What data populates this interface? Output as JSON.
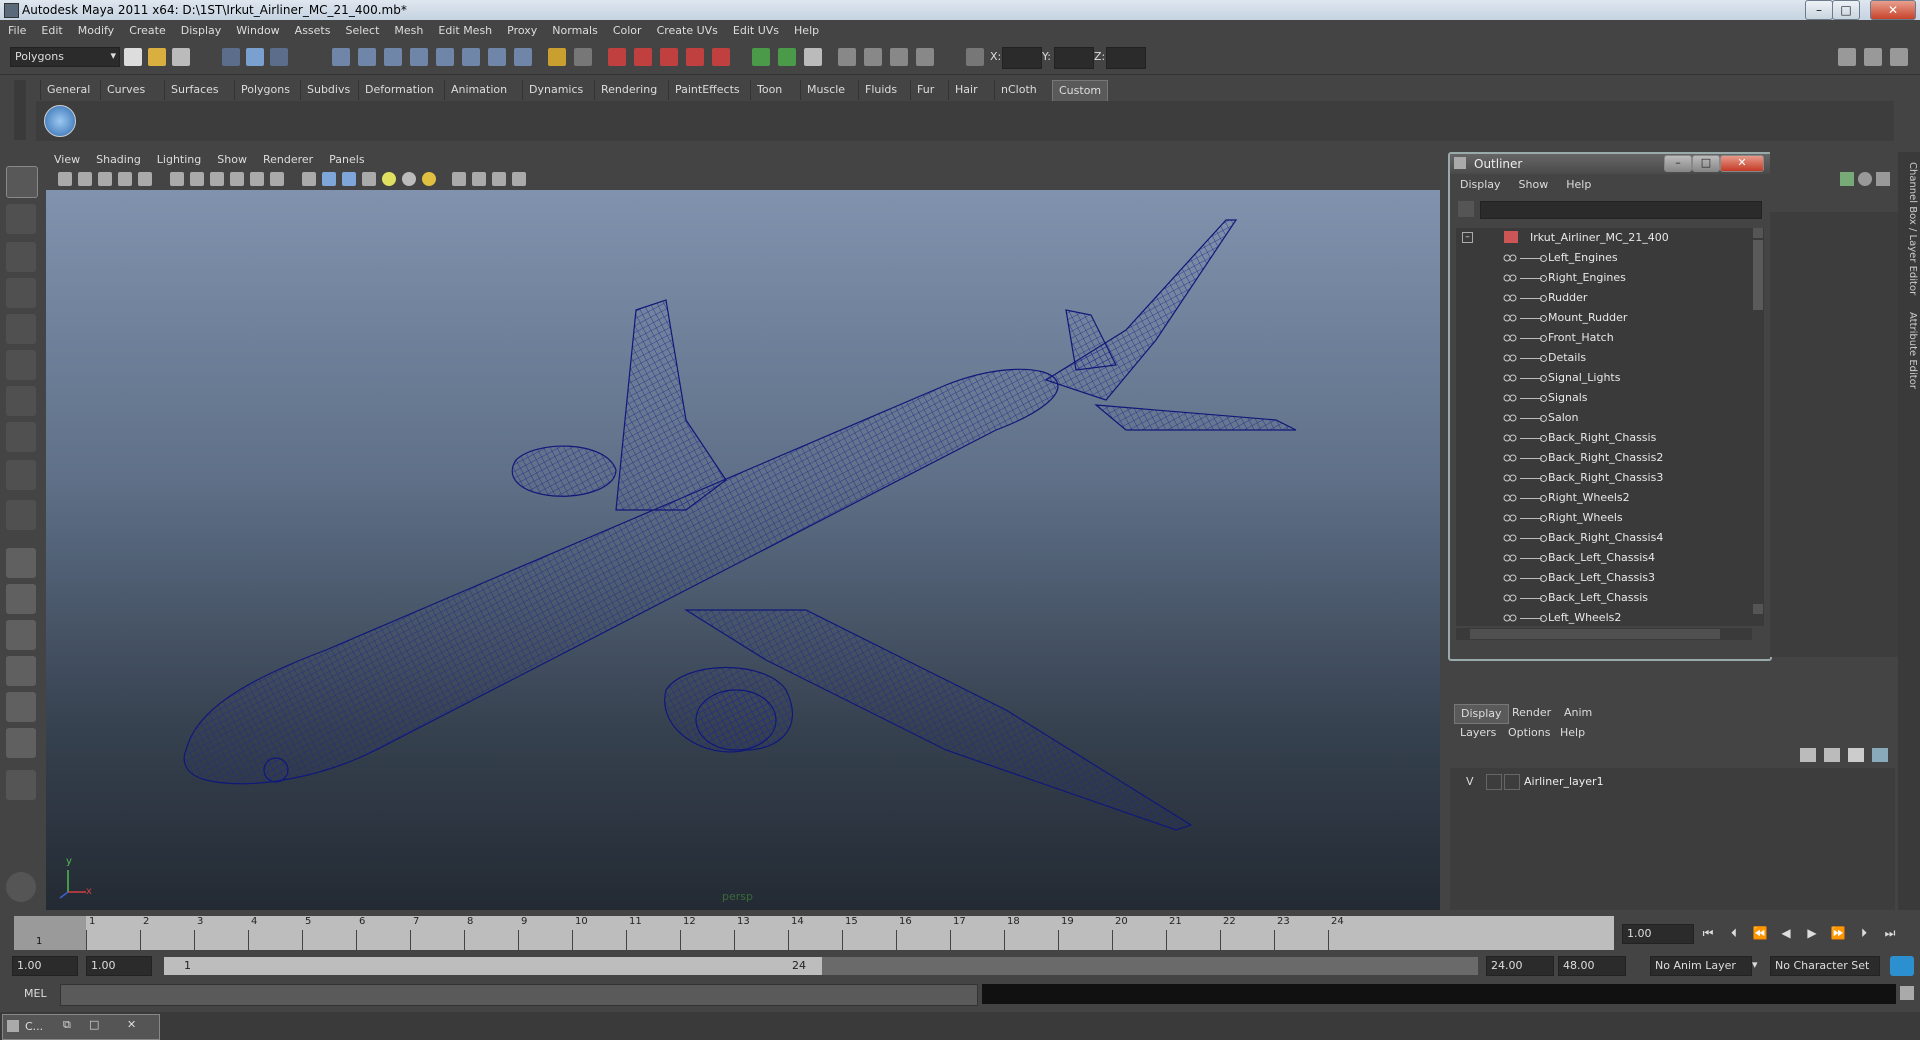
{
  "window": {
    "title": "Autodesk Maya 2011 x64: D:\\1ST\\Irkut_Airliner_MC_21_400.mb*"
  },
  "menubar": [
    "File",
    "Edit",
    "Modify",
    "Create",
    "Display",
    "Window",
    "Assets",
    "Select",
    "Mesh",
    "Edit Mesh",
    "Proxy",
    "Normals",
    "Color",
    "Create UVs",
    "Edit UVs",
    "Help"
  ],
  "status": {
    "mode": "Polygons",
    "x_label": "X:",
    "y_label": "Y:",
    "z_label": "Z:"
  },
  "shelf_tabs": [
    "General",
    "Curves",
    "Surfaces",
    "Polygons",
    "Subdivs",
    "Deformation",
    "Animation",
    "Dynamics",
    "Rendering",
    "PaintEffects",
    "Toon",
    "Muscle",
    "Fluids",
    "Fur",
    "Hair",
    "nCloth",
    "Custom"
  ],
  "shelf_active": "Custom",
  "viewport": {
    "menu": [
      "View",
      "Shading",
      "Lighting",
      "Show",
      "Renderer",
      "Panels"
    ],
    "camera_label": "persp",
    "axis_y": "y",
    "axis_x": "x",
    "wire_color": "#101878"
  },
  "outliner": {
    "title": "Outliner",
    "menu": [
      "Display",
      "Show",
      "Help"
    ],
    "root": "Irkut_Airliner_MC_21_400",
    "items": [
      "Left_Engines",
      "Right_Engines",
      "Rudder",
      "Mount_Rudder",
      "Front_Hatch",
      "Details",
      "Signal_Lights",
      "Signals",
      "Salon",
      "Back_Right_Chassis",
      "Back_Right_Chassis2",
      "Back_Right_Chassis3",
      "Right_Wheels2",
      "Right_Wheels",
      "Back_Right_Chassis4",
      "Back_Left_Chassis4",
      "Back_Left_Chassis3",
      "Back_Left_Chassis",
      "Left_Wheels2"
    ]
  },
  "side_tabs": [
    "Channel Box / Layer Editor",
    "Attribute Editor"
  ],
  "layers": {
    "tabs": [
      "Display",
      "Render",
      "Anim"
    ],
    "active_tab": "Display",
    "menu": [
      "Layers",
      "Options",
      "Help"
    ],
    "layer_visible": "V",
    "layer_name": "Airliner_layer1"
  },
  "timeline": {
    "ticks": [
      "1",
      "2",
      "3",
      "4",
      "5",
      "6",
      "7",
      "8",
      "9",
      "10",
      "11",
      "12",
      "13",
      "14",
      "15",
      "16",
      "17",
      "18",
      "19",
      "20",
      "21",
      "22",
      "23",
      "24"
    ],
    "start_marker": "1",
    "current_frame": "1.00"
  },
  "range": {
    "start": "1.00",
    "start2": "1.00",
    "slider_start": "1",
    "slider_end": "24",
    "end": "24.00",
    "end2": "48.00",
    "anim_layer": "No Anim Layer",
    "character_set": "No Character Set"
  },
  "cmdline": {
    "label": "MEL"
  },
  "taskbar": {
    "minimized_label": "C..."
  }
}
